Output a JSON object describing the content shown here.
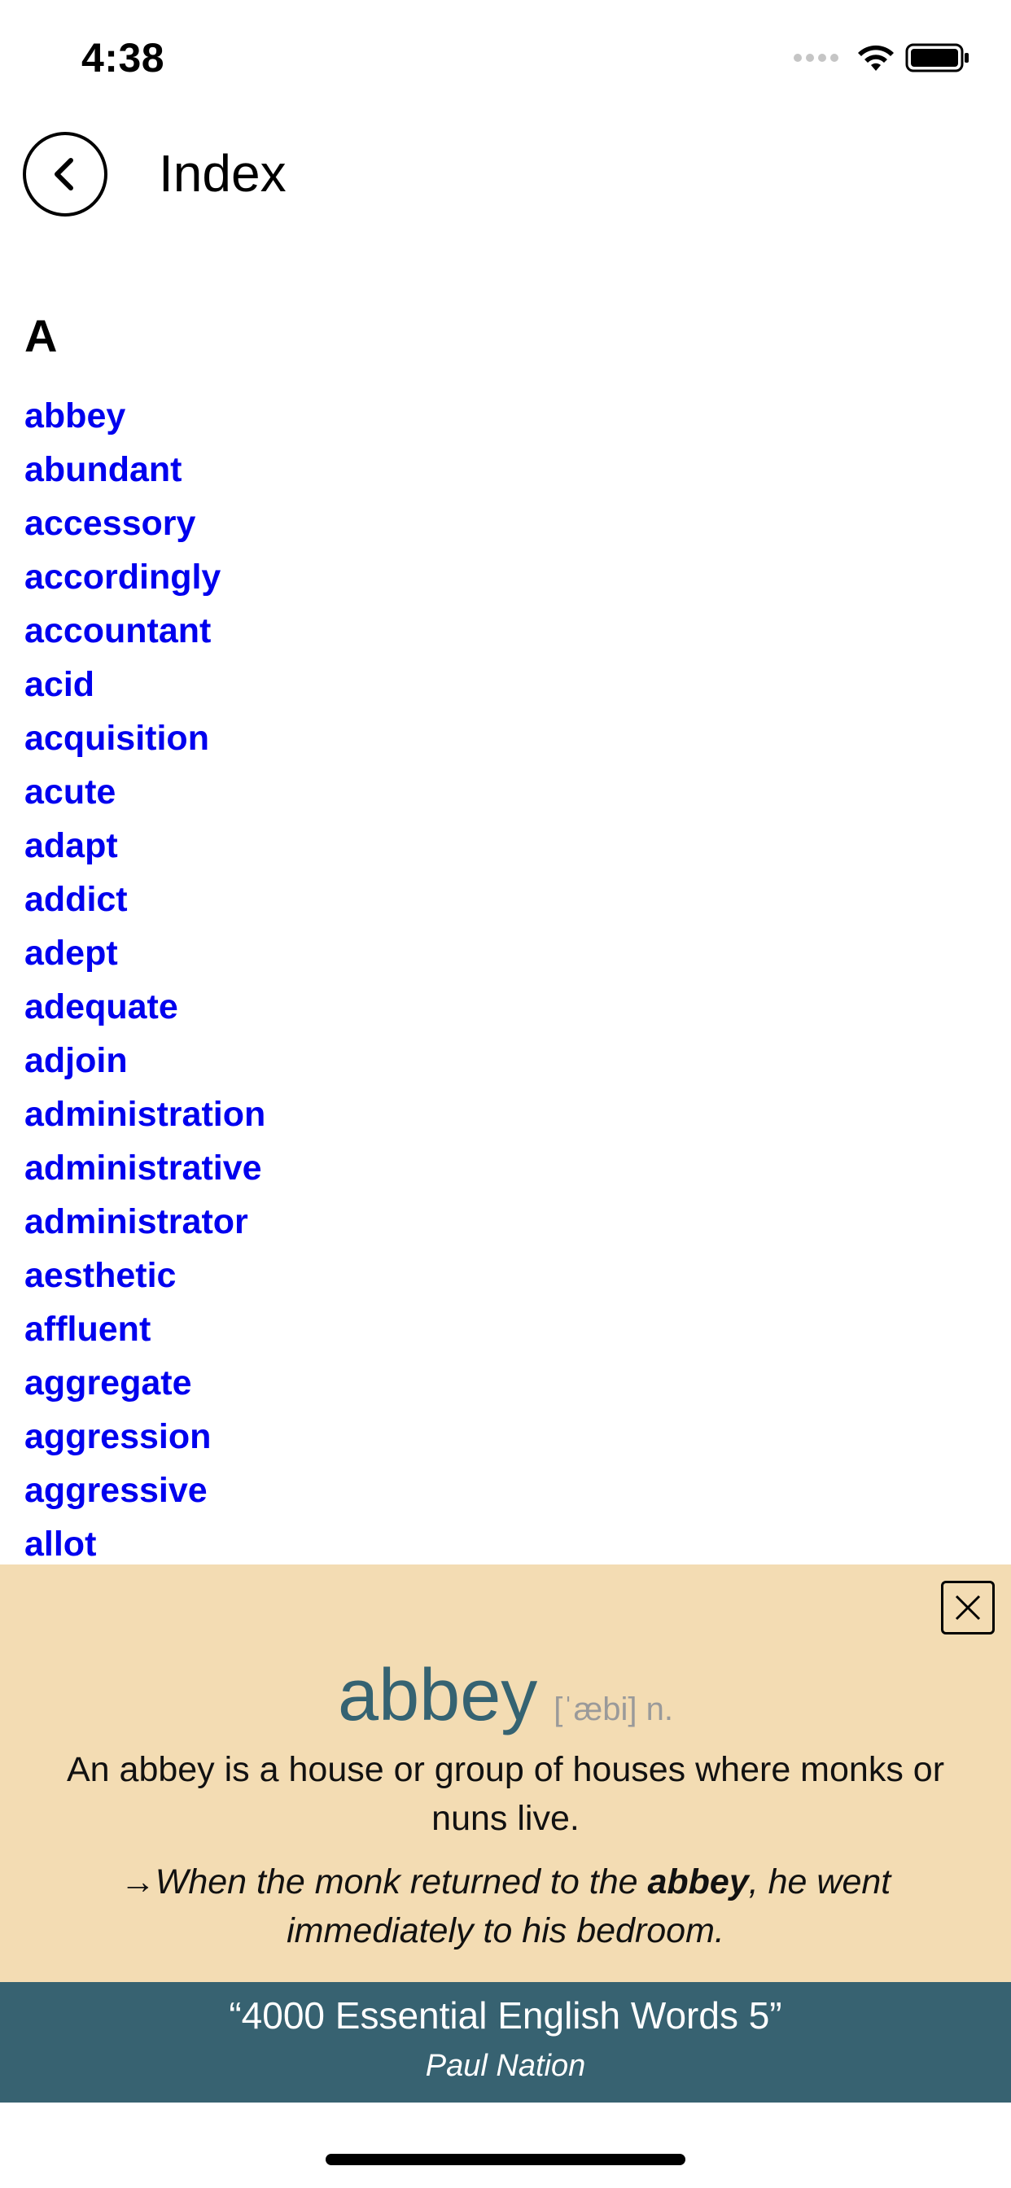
{
  "status_bar": {
    "time": "4:38",
    "icons": [
      "signal-dots-icon",
      "wifi-icon",
      "battery-icon"
    ]
  },
  "header": {
    "title": "Index",
    "back_icon": "chevron-left-icon"
  },
  "index": {
    "section_letter": "A",
    "words": [
      "abbey",
      "abundant",
      "accessory",
      "accordingly",
      "accountant",
      "acid",
      "acquisition",
      "acute",
      "adapt",
      "addict",
      "adept",
      "adequate",
      "adjoin",
      "administration",
      "administrative",
      "administrator",
      "aesthetic",
      "affluent",
      "aggregate",
      "aggression",
      "aggressive",
      "allot"
    ],
    "link_color": "#0000ee"
  },
  "definition": {
    "word": "abbey",
    "pronunciation": "[ˈæbi] n.",
    "meaning": "An abbey is a house or group of houses where monks or nuns live.",
    "example_prefix": "→When the monk returned to the ",
    "example_highlight": "abbey",
    "example_suffix": ", he went immediately to his bedroom.",
    "close_icon": "close-icon",
    "panel_color": "#f3dcb3",
    "word_color": "#356372"
  },
  "book": {
    "title": "“4000 Essential English Words 5”",
    "author": "Paul Nation",
    "banner_color": "#376271"
  }
}
